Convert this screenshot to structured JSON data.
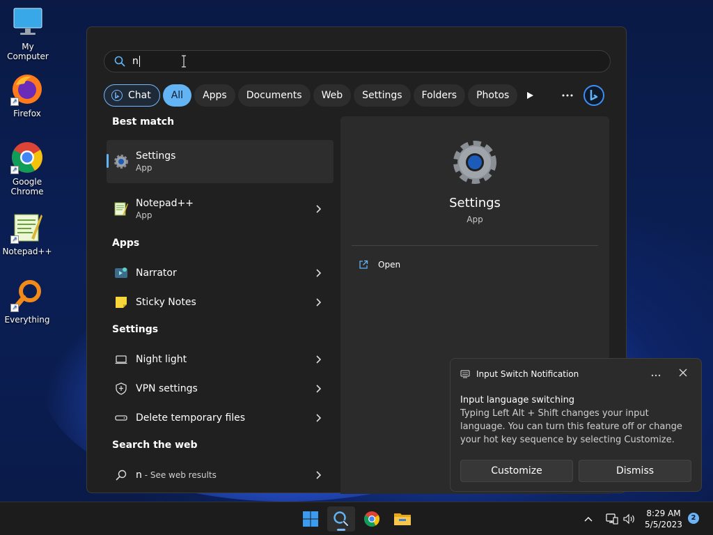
{
  "desktop": {
    "icons": [
      {
        "label": "My Computer"
      },
      {
        "label": "Firefox"
      },
      {
        "label": "Google Chrome"
      },
      {
        "label": "Notepad++"
      },
      {
        "label": "Everything"
      }
    ]
  },
  "search": {
    "query": "n"
  },
  "filters": {
    "chat": "Chat",
    "all": "All",
    "apps": "Apps",
    "documents": "Documents",
    "web": "Web",
    "settings": "Settings",
    "folders": "Folders",
    "photos": "Photos"
  },
  "results": {
    "best_match_title": "Best match",
    "best_match": {
      "name": "Settings",
      "type": "App"
    },
    "notepad": {
      "name": "Notepad++",
      "type": "App"
    },
    "apps_title": "Apps",
    "apps": [
      {
        "name": "Narrator"
      },
      {
        "name": "Sticky Notes"
      }
    ],
    "settings_title": "Settings",
    "settings": [
      {
        "name": "Night light"
      },
      {
        "name": "VPN settings"
      },
      {
        "name": "Delete temporary files"
      }
    ],
    "web_title": "Search the web",
    "web": {
      "query": "n",
      "suffix": " - See web results"
    }
  },
  "detail": {
    "title": "Settings",
    "type": "App",
    "open": "Open"
  },
  "toast": {
    "header": "Input Switch Notification",
    "heading": "Input language switching",
    "text": "Typing Left Alt + Shift changes your input language. You can turn this feature off or change your hot key sequence by selecting Customize.",
    "customize": "Customize",
    "dismiss": "Dismiss"
  },
  "taskbar": {
    "time": "8:29 AM",
    "date": "5/5/2023",
    "badge": "2"
  },
  "colors": {
    "accent": "#63b4f5",
    "panel": "#202020"
  }
}
